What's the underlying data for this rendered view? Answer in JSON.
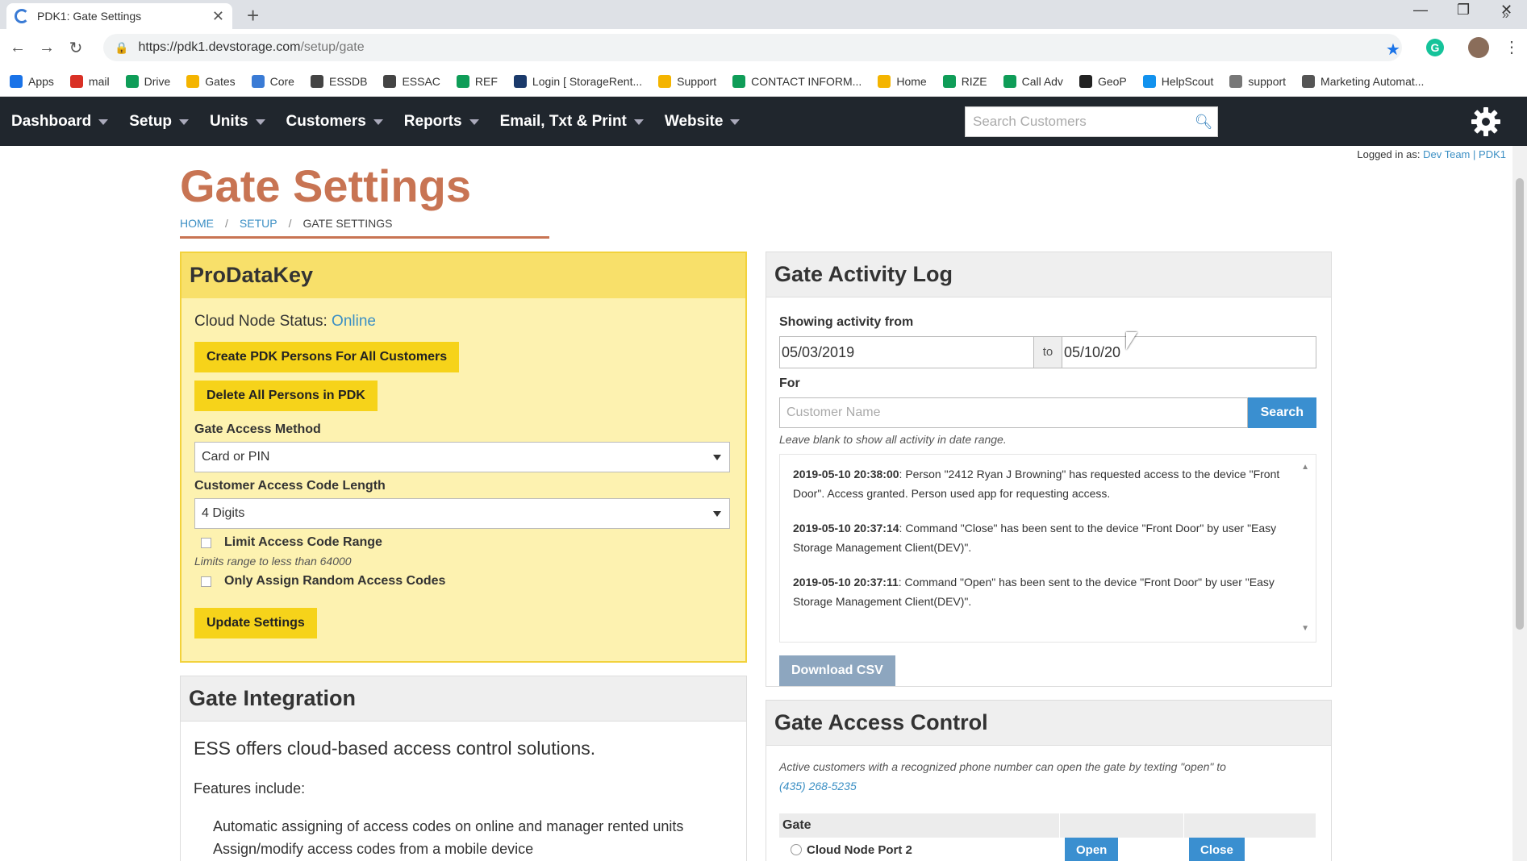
{
  "browser": {
    "tab_title": "PDK1: Gate Settings",
    "url_host": "https://pdk1.devstorage.com",
    "url_path": "/setup/gate",
    "bookmarks": [
      {
        "label": "Apps",
        "color": "#1a73e8"
      },
      {
        "label": "mail",
        "color": "#d93025"
      },
      {
        "label": "Drive",
        "color": "#0f9d58"
      },
      {
        "label": "Gates",
        "color": "#f4b400"
      },
      {
        "label": "Core",
        "color": "#3a7bd5"
      },
      {
        "label": "ESSDB",
        "color": "#444444"
      },
      {
        "label": "ESSAC",
        "color": "#444444"
      },
      {
        "label": "REF",
        "color": "#0f9d58"
      },
      {
        "label": "Login [ StorageRent...",
        "color": "#1b3a6b"
      },
      {
        "label": "Support",
        "color": "#f4b400"
      },
      {
        "label": "CONTACT INFORM...",
        "color": "#0f9d58"
      },
      {
        "label": "Home",
        "color": "#f4b400"
      },
      {
        "label": "RIZE",
        "color": "#0f9d58"
      },
      {
        "label": "Call Adv",
        "color": "#0f9d58"
      },
      {
        "label": "GeoP",
        "color": "#222222"
      },
      {
        "label": "HelpScout",
        "color": "#1292ee"
      },
      {
        "label": "support",
        "color": "#777777"
      },
      {
        "label": "Marketing Automat...",
        "color": "#555555"
      }
    ]
  },
  "nav": {
    "items": [
      "Dashboard",
      "Setup",
      "Units",
      "Customers",
      "Reports",
      "Email, Txt & Print",
      "Website"
    ],
    "search_placeholder": "Search Customers"
  },
  "session": {
    "logged_in_prefix": "Logged in as:",
    "user": "Dev Team",
    "separator": "|",
    "site": "PDK1"
  },
  "page": {
    "title": "Gate Settings",
    "breadcrumb": [
      "HOME",
      "SETUP",
      "GATE SETTINGS"
    ]
  },
  "pdk": {
    "heading": "ProDataKey",
    "status_label": "Cloud Node Status:",
    "status_value": "Online",
    "create_button": "Create PDK Persons For All Customers",
    "delete_button": "Delete All Persons in PDK",
    "access_method_label": "Gate Access Method",
    "access_method_value": "Card or PIN",
    "code_length_label": "Customer Access Code Length",
    "code_length_value": "4 Digits",
    "limit_range_label": "Limit Access Code Range",
    "limit_range_hint": "Limits range to less than 64000",
    "random_codes_label": "Only Assign Random Access Codes",
    "update_button": "Update Settings"
  },
  "integration": {
    "heading": "Gate Integration",
    "lead": "ESS offers cloud-based access control solutions.",
    "features_label": "Features include:",
    "features": [
      "Automatic assigning of access codes on online and manager rented units",
      "Assign/modify access codes from a mobile device"
    ]
  },
  "activity": {
    "heading": "Gate Activity Log",
    "from_label": "Showing activity from",
    "date_from": "05/03/2019",
    "to_label": "to",
    "date_to": "05/10/20",
    "for_label": "For",
    "customer_placeholder": "Customer Name",
    "search_button": "Search",
    "hint": "Leave blank to show all activity in date range.",
    "entries": [
      {
        "time": "2019-05-10 20:38:00",
        "text": ": Person \"2412 Ryan J Browning\" has requested access to the device \"Front Door\". Access granted. Person used app for requesting access."
      },
      {
        "time": "2019-05-10 20:37:14",
        "text": ": Command \"Close\" has been sent to the device \"Front Door\" by user \"Easy Storage Management Client(DEV)\"."
      },
      {
        "time": "2019-05-10 20:37:11",
        "text": ": Command \"Open\" has been sent to the device \"Front Door\" by user \"Easy Storage Management Client(DEV)\"."
      }
    ],
    "download_button": "Download CSV"
  },
  "access_control": {
    "heading": "Gate Access Control",
    "note": "Active customers with a recognized phone number can open the gate by texting \"open\" to",
    "phone": "(435) 268-5235",
    "table_header": "Gate",
    "rows": [
      {
        "gate": "Cloud Node Port 2",
        "open": "Open",
        "close": "Close"
      }
    ]
  }
}
